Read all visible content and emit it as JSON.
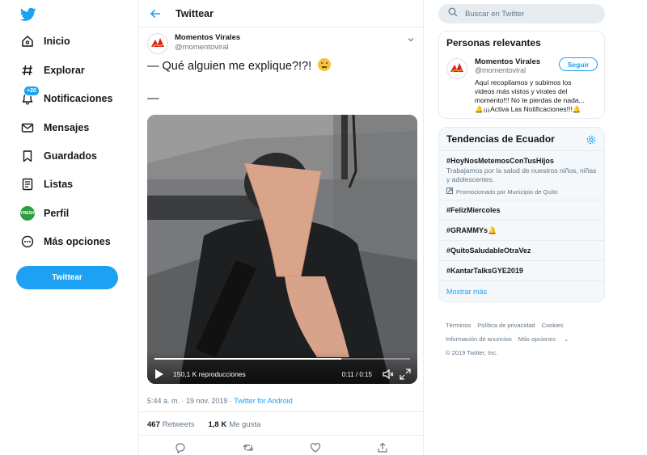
{
  "nav": {
    "items": [
      {
        "label": "Inicio",
        "icon": "home-icon"
      },
      {
        "label": "Explorar",
        "icon": "hashtag-icon"
      },
      {
        "label": "Notificaciones",
        "icon": "bell-icon",
        "badge": "+20"
      },
      {
        "label": "Mensajes",
        "icon": "envelope-icon"
      },
      {
        "label": "Guardados",
        "icon": "bookmark-icon"
      },
      {
        "label": "Listas",
        "icon": "list-icon"
      },
      {
        "label": "Perfil",
        "icon": "avatar"
      },
      {
        "label": "Más opciones",
        "icon": "more-icon"
      }
    ],
    "tweet_button": "Twittear",
    "brand_color": "#1da1f2"
  },
  "main": {
    "title": "Twittear",
    "tweet": {
      "name": "Momentos Virales",
      "handle": "@momentoviral",
      "text": "— Qué alguien me explique?!?! ",
      "text_line2": "—",
      "video": {
        "views": "150,1 K reproducciones",
        "time": "0:11 / 0:15",
        "progress": 0.73
      },
      "timestamp": "5:44 a. m. · 19 nov. 2019 · ",
      "source": "Twitter for Android",
      "retweets_count": "467",
      "retweets_label": "Retweets",
      "likes_count": "1,8 K",
      "likes_label": "Me gusta"
    }
  },
  "right": {
    "search_placeholder": "Buscar en Twitter",
    "people": {
      "title": "Personas relevantes",
      "name": "Momentos Virales",
      "handle": "@momentoviral",
      "follow": "Seguir",
      "bio": "Aquí recopilamos y subimos los videos más vistos y virales del momento!!! No te pierdas de nada... 🔔¡¡¡Activa Las Notificaciones!!!🔔"
    },
    "trends": {
      "title": "Tendencias de Ecuador",
      "items": [
        {
          "tag": "#HoyNosMetemosConTusHijos",
          "desc": "Trabajamos por la salud de nuestros niños, niñas y adolescentes.",
          "promo": "Promocionado por Municipio de Quito"
        },
        {
          "tag": "#FelizMiercoles"
        },
        {
          "tag": "#GRAMMYs🔔"
        },
        {
          "tag": "#QuitoSaludableOtraVez"
        },
        {
          "tag": "#KantarTalksGYE2019"
        }
      ],
      "show_more": "Mostrar más"
    },
    "footer": {
      "links": [
        "Términos",
        "Política de privacidad",
        "Cookies",
        "Información de anuncios",
        "Más opciones"
      ],
      "copyright": "© 2019 Twitter, Inc."
    }
  }
}
